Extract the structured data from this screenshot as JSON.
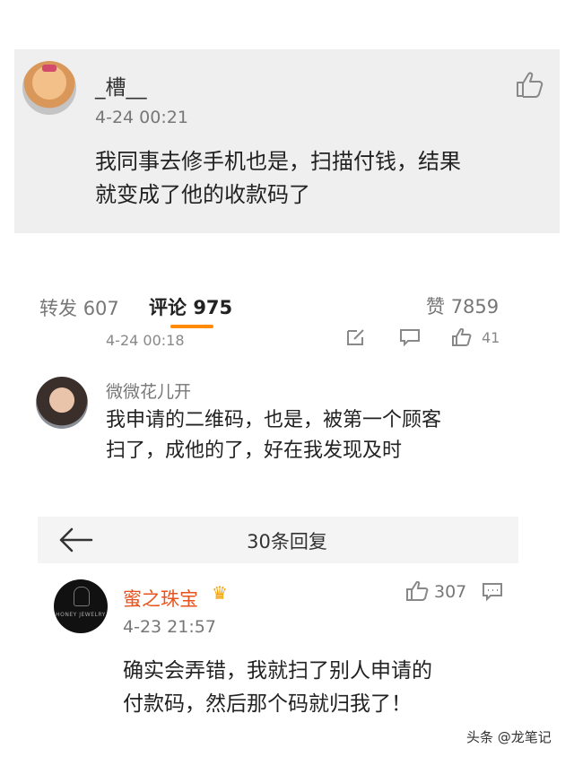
{
  "comment1": {
    "username": "_槽__",
    "timestamp": "4-24 00:21",
    "text_line1": "我同事去修手机也是，扫描付钱，结果",
    "text_line2": "就变成了他的收款码了"
  },
  "tabs": {
    "repost_label": "转发",
    "repost_count": "607",
    "comment_label": "评论",
    "comment_count": "975",
    "like_label": "赞",
    "like_count": "7859"
  },
  "strip": {
    "timestamp": "4-24 00:18",
    "like_count": "41"
  },
  "comment2": {
    "username": "微微花儿开",
    "text_line1": "我申请的二维码，也是，被第一个顾客",
    "text_line2": "扫了，成他的了，好在我发现及时"
  },
  "reply_panel": {
    "title": "30条回复"
  },
  "comment3": {
    "username": "蜜之珠宝",
    "avatar_brand": "HONEY JEWELRY",
    "timestamp": "4-23 21:57",
    "like_count": "307",
    "text_line1": "确实会弄错，我就扫了别人申请的",
    "text_line2": "付款码，然后那个码就归我了！"
  },
  "watermark": "头条 @龙笔记",
  "colors": {
    "accent": "#ff8a00",
    "vip_name": "#e8531d"
  }
}
